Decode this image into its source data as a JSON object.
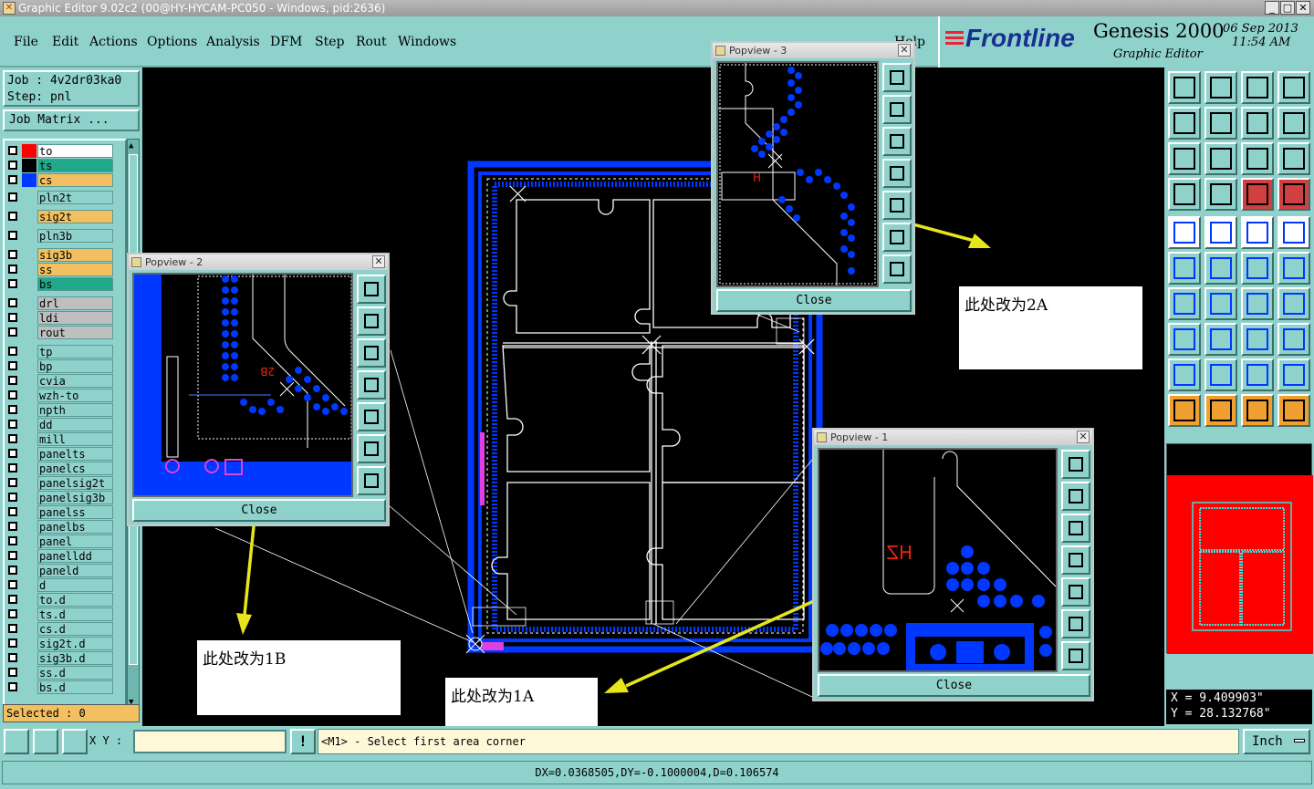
{
  "window": {
    "title": "Graphic Editor 9.02c2 (00@HY-HYCAM-PC050 - Windows, pid:2636)"
  },
  "menu": {
    "items": [
      "File",
      "Edit",
      "Actions",
      "Options",
      "Analysis",
      "DFM",
      "Step",
      "Rout",
      "Windows"
    ],
    "help": "Help"
  },
  "brand": {
    "logo": "Frontline",
    "product": "Genesis 2000",
    "subtitle": "Graphic Editor",
    "date": "06 Sep 2013",
    "time": "11:54 AM"
  },
  "job": {
    "job_label": "Job : 4v2dr03ka0",
    "step_label": "Step: pnl",
    "matrix_button": "Job Matrix ..."
  },
  "layers": [
    {
      "name": "to",
      "color": "#ffffff",
      "swatch": "#ff0000"
    },
    {
      "name": "ts",
      "color": "#1fa88a",
      "swatch": "#000000"
    },
    {
      "name": "cs",
      "color": "#f2c060",
      "swatch": "#0038ff"
    },
    {
      "name": "pln2t",
      "color": "#8fd2cc",
      "swatch": ""
    },
    {
      "name": "sig2t",
      "color": "#f2c060",
      "swatch": ""
    },
    {
      "name": "pln3b",
      "color": "#8fd2cc",
      "swatch": ""
    },
    {
      "name": "sig3b",
      "color": "#f2c060",
      "swatch": ""
    },
    {
      "name": "ss",
      "color": "#f2c060",
      "swatch": ""
    },
    {
      "name": "bs",
      "color": "#1fa88a",
      "swatch": ""
    },
    {
      "name": "drl",
      "color": "#bfbfbf",
      "swatch": ""
    },
    {
      "name": "ldi",
      "color": "#bfbfbf",
      "swatch": ""
    },
    {
      "name": "rout",
      "color": "#bfbfbf",
      "swatch": ""
    },
    {
      "name": "tp",
      "color": "#8fd2cc",
      "swatch": ""
    },
    {
      "name": "bp",
      "color": "#8fd2cc",
      "swatch": ""
    },
    {
      "name": "cvia",
      "color": "#8fd2cc",
      "swatch": ""
    },
    {
      "name": "wzh-to",
      "color": "#8fd2cc",
      "swatch": ""
    },
    {
      "name": "npth",
      "color": "#8fd2cc",
      "swatch": ""
    },
    {
      "name": "dd",
      "color": "#8fd2cc",
      "swatch": ""
    },
    {
      "name": "mill",
      "color": "#8fd2cc",
      "swatch": ""
    },
    {
      "name": "panelts",
      "color": "#8fd2cc",
      "swatch": ""
    },
    {
      "name": "panelcs",
      "color": "#8fd2cc",
      "swatch": ""
    },
    {
      "name": "panelsig2t",
      "color": "#8fd2cc",
      "swatch": ""
    },
    {
      "name": "panelsig3b",
      "color": "#8fd2cc",
      "swatch": ""
    },
    {
      "name": "panelss",
      "color": "#8fd2cc",
      "swatch": ""
    },
    {
      "name": "panelbs",
      "color": "#8fd2cc",
      "swatch": ""
    },
    {
      "name": "panel",
      "color": "#8fd2cc",
      "swatch": ""
    },
    {
      "name": "panelldd",
      "color": "#8fd2cc",
      "swatch": ""
    },
    {
      "name": "paneld",
      "color": "#8fd2cc",
      "swatch": ""
    },
    {
      "name": "d",
      "color": "#8fd2cc",
      "swatch": ""
    },
    {
      "name": "to.d",
      "color": "#8fd2cc",
      "swatch": ""
    },
    {
      "name": "ts.d",
      "color": "#8fd2cc",
      "swatch": ""
    },
    {
      "name": "cs.d",
      "color": "#8fd2cc",
      "swatch": ""
    },
    {
      "name": "sig2t.d",
      "color": "#8fd2cc",
      "swatch": ""
    },
    {
      "name": "sig3b.d",
      "color": "#8fd2cc",
      "swatch": ""
    },
    {
      "name": "ss.d",
      "color": "#8fd2cc",
      "swatch": ""
    },
    {
      "name": "bs.d",
      "color": "#8fd2cc",
      "swatch": ""
    }
  ],
  "selected": "Selected : 0",
  "popviews": {
    "p1": {
      "title": "Popview - 1",
      "close": "Close",
      "label": "HZ"
    },
    "p2": {
      "title": "Popview - 2",
      "close": "Close",
      "label": "2B"
    },
    "p3": {
      "title": "Popview - 3",
      "close": "Close",
      "label": "H"
    }
  },
  "notes": {
    "n2a": "此处改为2A",
    "n1b": "此处改为1B",
    "n1a": "此处改为1A"
  },
  "coords": {
    "x": "X = 9.409903\"",
    "y": "Y = 28.132768\""
  },
  "bottom": {
    "xy_label": "X Y :",
    "xy_value": "",
    "prompt": "<M1> - Select first area corner",
    "units": "Inch"
  },
  "status": {
    "delta": "DX=0.0368505,DY=-0.1000004,D=0.106574"
  },
  "colors": {
    "panel": "#8fd2cc",
    "signal": "#0038ff",
    "annotation_arrow": "#e6e61a"
  }
}
